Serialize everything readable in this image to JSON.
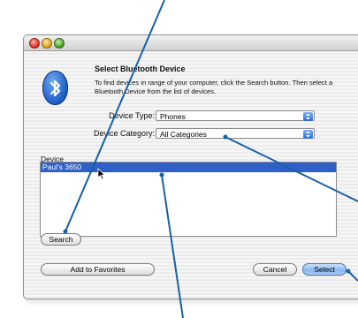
{
  "dialog": {
    "heading": "Select Bluetooth Device",
    "description": "To find devices in range of your computer, click the Search button. Then select a Bluetooth Device from the list of devices.",
    "device_type_label": "Device Type:",
    "device_type_value": "Phones",
    "device_category_label": "Device Category:",
    "device_category_value": "All Categories",
    "list_header": "Device",
    "devices": [
      "Paul's 3650"
    ],
    "search_button": "Search",
    "favorites_button": "Add to Favorites",
    "cancel_button": "Cancel",
    "select_button": "Select"
  },
  "colors": {
    "selection": "#2f60c8",
    "callout_line": "#1560a8",
    "default_button": "#8cb6ef"
  },
  "icons": [
    "bluetooth-icon",
    "close-light",
    "minimize-light",
    "zoom-light",
    "popup-arrows-icon",
    "mouse-pointer-icon"
  ]
}
